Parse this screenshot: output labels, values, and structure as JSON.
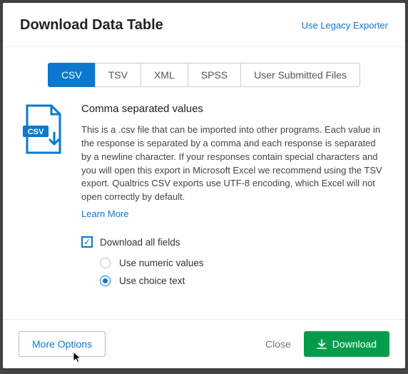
{
  "header": {
    "title": "Download Data Table",
    "legacy_link": "Use Legacy Exporter"
  },
  "tabs": [
    {
      "label": "CSV",
      "active": true
    },
    {
      "label": "TSV",
      "active": false
    },
    {
      "label": "XML",
      "active": false
    },
    {
      "label": "SPSS",
      "active": false
    },
    {
      "label": "User Submitted Files",
      "active": false
    }
  ],
  "panel": {
    "subtitle": "Comma separated values",
    "description": "This is a .csv file that can be imported into other programs. Each value in the response is separated by a comma and each response is separated by a newline character. If your responses contain special characters and you will open this export in Microsoft Excel we recommend using the TSV export. Qualtrics CSV exports use UTF-8 encoding, which Excel will not open correctly by default.",
    "learn_more": "Learn More",
    "file_badge": "CSV"
  },
  "options": {
    "download_all_label": "Download all fields",
    "download_all_checked": true,
    "radio": [
      {
        "label": "Use numeric values",
        "selected": false
      },
      {
        "label": "Use choice text",
        "selected": true
      }
    ]
  },
  "footer": {
    "more_options": "More Options",
    "close": "Close",
    "download": "Download"
  }
}
